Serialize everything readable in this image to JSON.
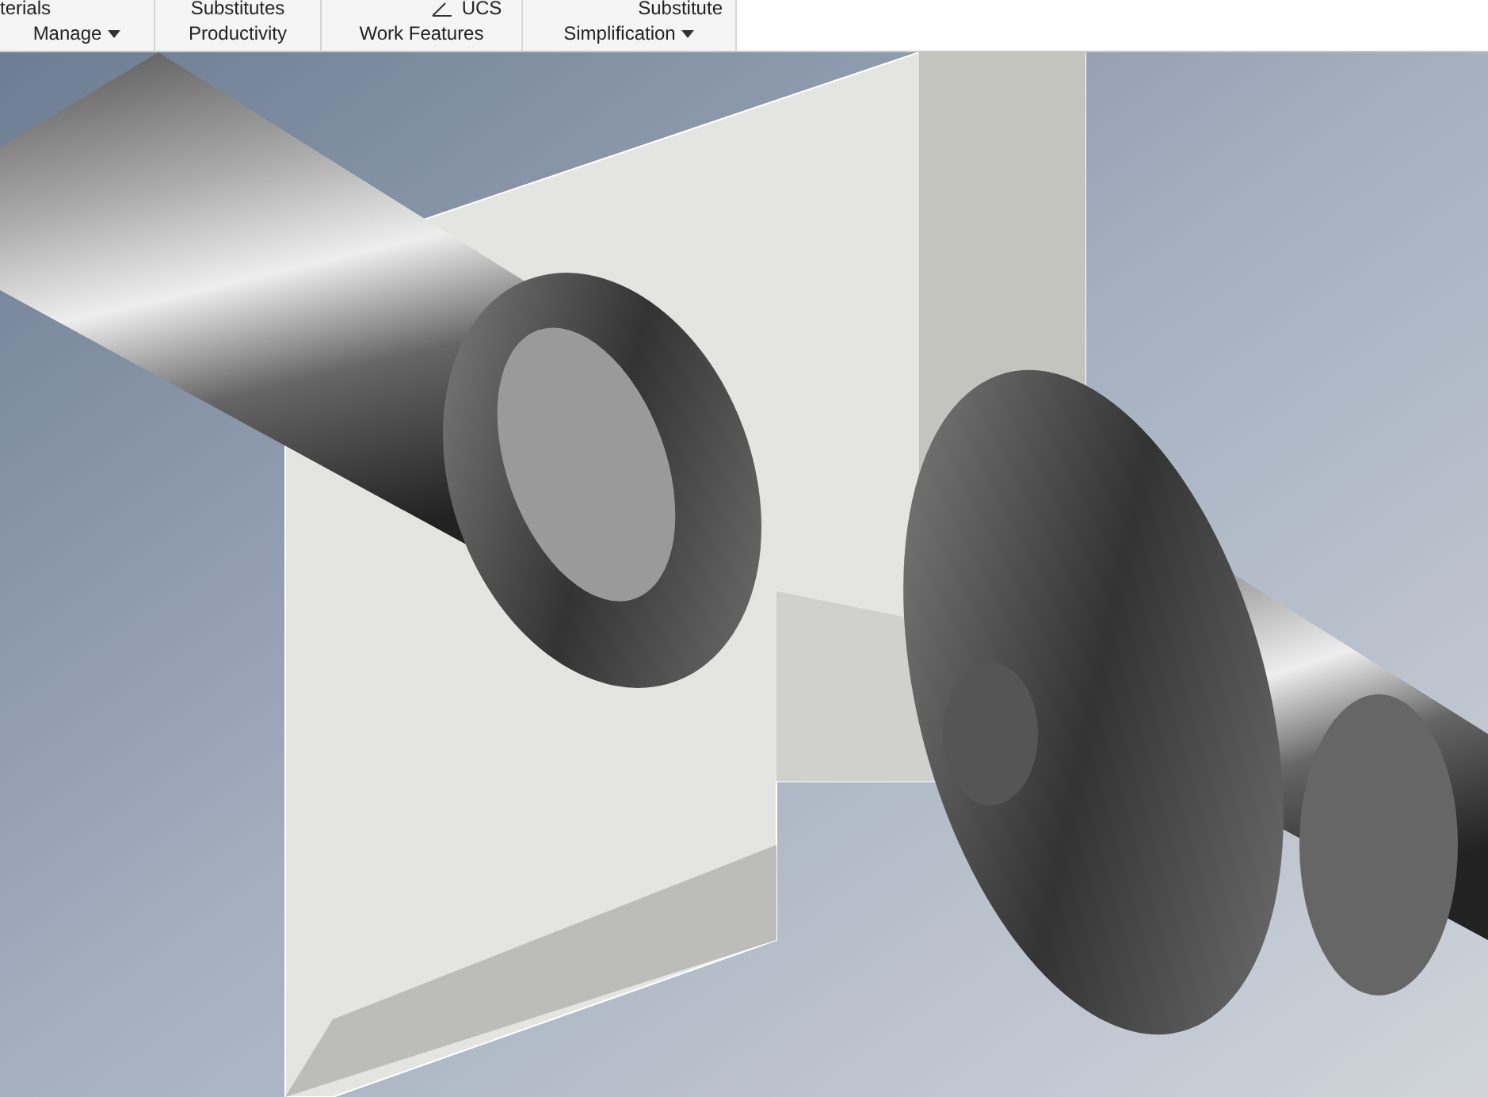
{
  "ribbon": {
    "panels": [
      {
        "top_label": "terials",
        "label": "Manage",
        "has_menu": true
      },
      {
        "top_label": "Substitutes",
        "label": "Productivity",
        "has_menu": false
      },
      {
        "top_label": "UCS",
        "label": "Work Features",
        "has_menu": false
      },
      {
        "top_label": "Substitute",
        "label": "Simplification",
        "has_menu": true
      }
    ]
  }
}
